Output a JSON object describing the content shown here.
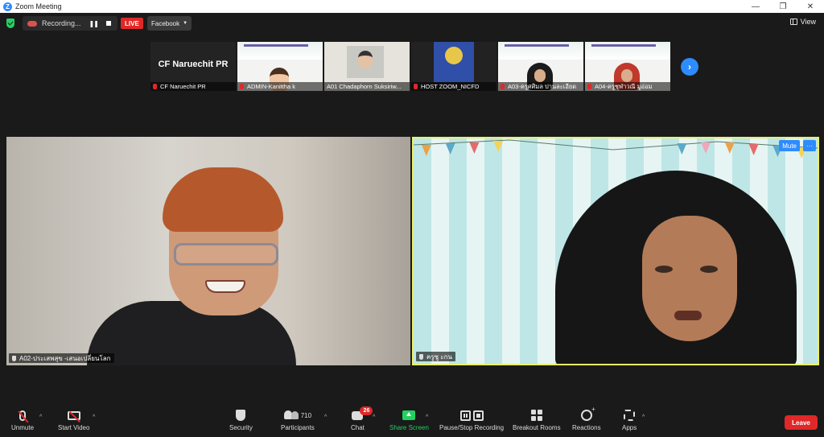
{
  "window": {
    "title": "Zoom Meeting",
    "minimize": "—",
    "maximize": "❐",
    "close": "✕"
  },
  "topbar": {
    "recording_label": "Recording...",
    "pause_glyph": "❚❚",
    "live_label": "LIVE",
    "stream_target": "Facebook",
    "view_label": "View"
  },
  "thumbnails": [
    {
      "name": "CF Naruechit PR",
      "display_name": "CF Naruechit PR",
      "type": "text"
    },
    {
      "name": "ADMIN-Kanittha k",
      "type": "cartoon"
    },
    {
      "name": "A01 Chadaphorn Suksiriw...",
      "type": "photo"
    },
    {
      "name": "HOST ZOOM_NICFD",
      "type": "logo"
    },
    {
      "name": "A03-ครูศศิมล ปานละเอียด",
      "type": "hijab-dark"
    },
    {
      "name": "A04-ครูชุฬาวณี มูอ่อม",
      "type": "hijab-red"
    }
  ],
  "next_glyph": "›",
  "main_left": {
    "name": "A02-ประเสพสุข -เสนอเปลี่ยนโลก"
  },
  "main_right": {
    "name": "ครูซู ะกน",
    "mute_label": "Mute",
    "more_label": "···"
  },
  "toolbar": {
    "unmute": "Unmute",
    "start_video": "Start Video",
    "security": "Security",
    "participants": "Participants",
    "participants_count": "710",
    "chat": "Chat",
    "chat_badge": "26",
    "share_screen": "Share Screen",
    "pause_stop_recording": "Pause/Stop Recording",
    "breakout_rooms": "Breakout Rooms",
    "reactions": "Reactions",
    "apps": "Apps",
    "leave": "Leave",
    "caret": "^"
  }
}
